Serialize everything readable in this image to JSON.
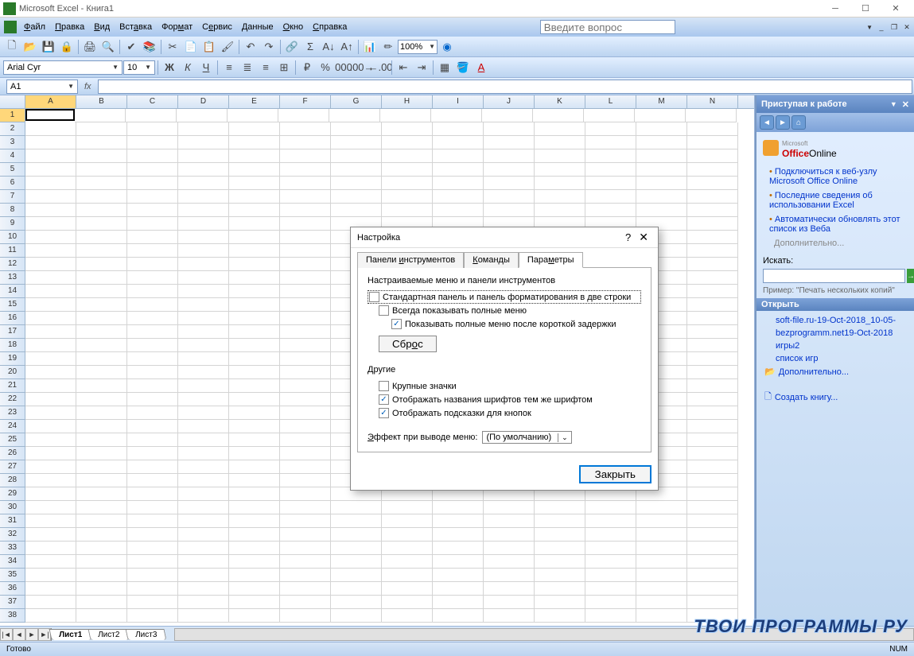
{
  "window": {
    "title": "Microsoft Excel - Книга1",
    "question_placeholder": "Введите вопрос"
  },
  "menu": {
    "file": "Файл",
    "edit": "Правка",
    "view": "Вид",
    "insert": "Вставка",
    "format": "Формат",
    "service": "Сервис",
    "data": "Данные",
    "window": "Окно",
    "help": "Справка"
  },
  "toolbar": {
    "zoom": "100%"
  },
  "format_bar": {
    "font": "Arial Cyr",
    "size": "10"
  },
  "formula": {
    "cell_ref": "A1",
    "fx": "fx"
  },
  "columns": [
    "A",
    "B",
    "C",
    "D",
    "E",
    "F",
    "G",
    "H",
    "I",
    "J",
    "K",
    "L",
    "M",
    "N"
  ],
  "rows": 38,
  "active_cell": {
    "row": 1,
    "col": 0
  },
  "sheets": {
    "tabs": [
      "Лист1",
      "Лист2",
      "Лист3"
    ],
    "active": 0
  },
  "taskpane": {
    "header": "Приступая к работе",
    "office": {
      "ms": "Microsoft",
      "brand": "Office",
      "online": "Online"
    },
    "links": [
      "Подключиться к веб-узлу Microsoft Office Online",
      "Последние сведения об использовании Excel",
      "Автоматически обновлять этот список из Веба"
    ],
    "more": "Дополнительно...",
    "search_label": "Искать:",
    "example": "Пример: \"Печать нескольких копий\"",
    "open_label": "Открыть",
    "recent": [
      "soft-file.ru-19-Oct-2018_10-05-",
      "bezprogramm.net19-Oct-2018",
      "игры2",
      "список игр"
    ],
    "more2": "Дополнительно...",
    "create": "Создать книгу..."
  },
  "dialog": {
    "title": "Настройка",
    "tabs": {
      "toolbars": "Панели инструментов",
      "commands": "Команды",
      "options": "Параметры"
    },
    "active_tab": "options",
    "group1_label": "Настраиваемые меню и панели инструментов",
    "chk_two_rows": {
      "label": "Стандартная панель и панель форматирования в две строки",
      "checked": false,
      "boxed": true
    },
    "chk_full_menus": {
      "label": "Всегда показывать полные меню",
      "checked": false
    },
    "chk_after_delay": {
      "label": "Показывать полные меню после короткой задержки",
      "checked": true
    },
    "reset_btn": "Сброс",
    "group2_label": "Другие",
    "chk_large_icons": {
      "label": "Крупные значки",
      "checked": false
    },
    "chk_font_names": {
      "label": "Отображать названия шрифтов тем же шрифтом",
      "checked": true
    },
    "chk_tooltips": {
      "label": "Отображать подсказки для кнопок",
      "checked": true
    },
    "effect_label": "Эффект при выводе меню:",
    "effect_value": "(По умолчанию)",
    "close_btn": "Закрыть"
  },
  "statusbar": {
    "ready": "Готово",
    "num": "NUM"
  },
  "watermark": "ТВОИ ПРОГРАММЫ РУ"
}
